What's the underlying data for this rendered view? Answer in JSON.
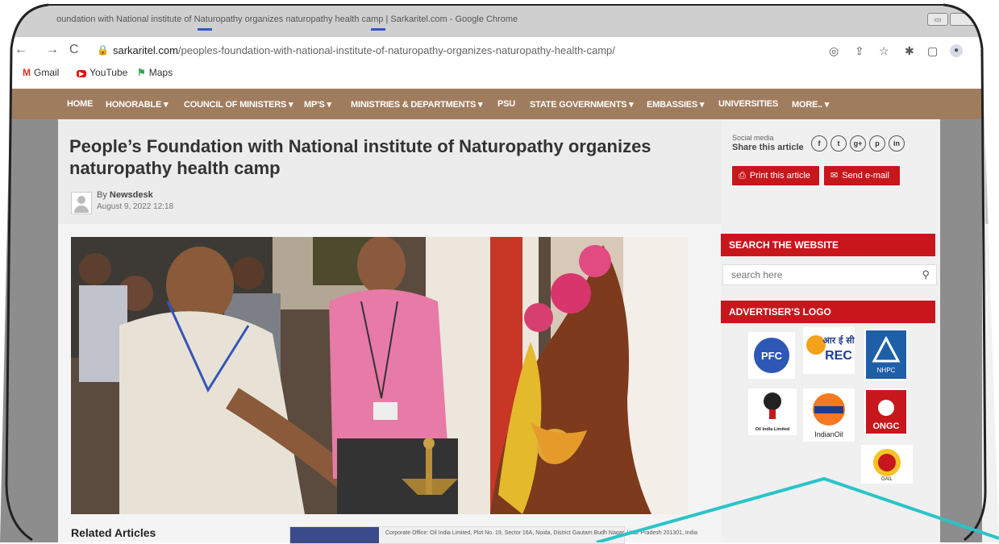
{
  "browser": {
    "window_title": "oundation with National institute of Naturopathy organizes naturopathy health camp | Sarkaritel.com - Google Chrome",
    "url_host": "sarkaritel.com",
    "url_path": "/peoples-foundation-with-national-institute-of-naturopathy-organizes-naturopathy-health-camp/",
    "bookmarks": [
      {
        "label": "Gmail",
        "icon": "gmail-icon"
      },
      {
        "label": "YouTube",
        "icon": "youtube-icon"
      },
      {
        "label": "Maps",
        "icon": "maps-icon"
      }
    ]
  },
  "nav": {
    "items": [
      "HOME",
      "HONORABLE ▾",
      "COUNCIL OF MINISTERS ▾",
      "MP'S ▾",
      "MINISTRIES & DEPARTMENTS ▾",
      "PSU",
      "STATE GOVERNMENTS ▾",
      "EMBASSIES ▾",
      "UNIVERSITIES",
      "MORE.. ▾"
    ]
  },
  "article": {
    "title": "People’s Foundation with National institute of Naturopathy organizes naturopathy health camp",
    "author_prefix": "By ",
    "author": "Newsdesk",
    "date": "August 9, 2022 12:18",
    "related_heading": "Related Articles",
    "ad_text": "Corporate Office: Oil India Limited, Plot No. 19, Sector 16A, Noida, District Gautam Budh Nagar, Uttar Pradesh 201301, India"
  },
  "sidebar": {
    "social_label": "Social media",
    "share_label": "Share this article",
    "social_icons": [
      "f",
      "t",
      "g+",
      "p",
      "in"
    ],
    "print_label": "Print this article",
    "email_label": "Send e-mail",
    "search_heading": "SEARCH THE WEBSITE",
    "search_placeholder": "search here",
    "advertiser_heading": "ADVERTISER'S LOGO",
    "logos": [
      {
        "name": "PFC",
        "text": "PFC"
      },
      {
        "name": "REC",
        "text_hi": "आर ई सी",
        "text": "REC"
      },
      {
        "name": "NHPC",
        "text": "NHPC"
      },
      {
        "name": "Oil India Limited",
        "text": "Oil India Limited"
      },
      {
        "name": "IndianOil",
        "text": "IndianOil"
      },
      {
        "name": "ONGC",
        "text": "ONGC"
      },
      {
        "name": "GAIL",
        "text": "GAIL"
      }
    ]
  },
  "colors": {
    "nav_bg": "#a07c5f",
    "accent_red": "#c8161d",
    "annotation_line": "#2ac4c8"
  }
}
